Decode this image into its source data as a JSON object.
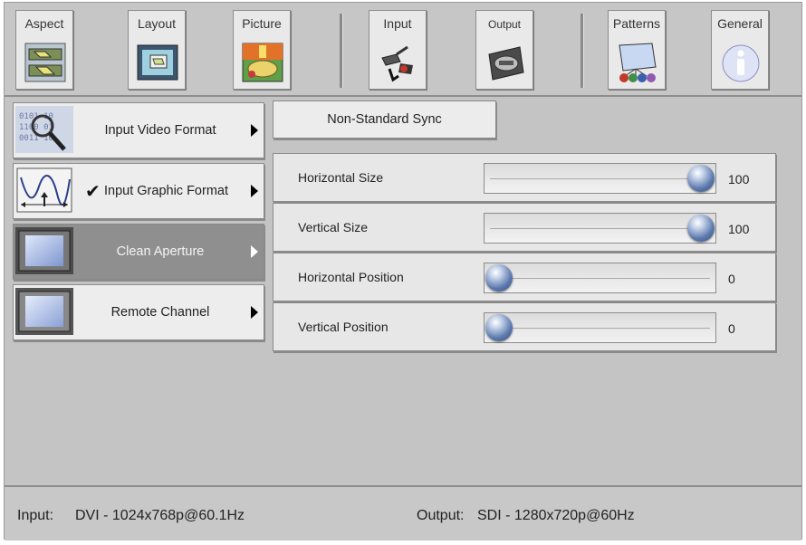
{
  "toolbar": {
    "tabs": [
      {
        "label": "Aspect",
        "icon": "aspect-icon"
      },
      {
        "label": "Layout",
        "icon": "layout-icon"
      },
      {
        "label": "Picture",
        "icon": "picture-icon"
      },
      {
        "label": "Input",
        "icon": "input-connector-icon"
      },
      {
        "label": "Output",
        "icon": "output-logo-icon"
      },
      {
        "label": "Patterns",
        "icon": "patterns-icon"
      },
      {
        "label": "General",
        "icon": "info-icon"
      }
    ]
  },
  "menu": {
    "items": [
      {
        "label": "Input Video Format",
        "icon": "magnifier-data-icon",
        "checked": false,
        "active": false
      },
      {
        "label": "Input Graphic Format",
        "icon": "waveform-icon",
        "checked": true,
        "check_mark": "✔",
        "active": false
      },
      {
        "label": "Clean Aperture",
        "icon": "aperture-frame-icon",
        "checked": false,
        "active": true
      },
      {
        "label": "Remote Channel",
        "icon": "frame-icon",
        "checked": false,
        "active": false
      }
    ]
  },
  "panel": {
    "button_label": "Non-Standard Sync",
    "rows": [
      {
        "label": "Horizontal Size",
        "value": "100",
        "level": 1.0
      },
      {
        "label": "Vertical Size",
        "value": "100",
        "level": 1.0
      },
      {
        "label": "Horizontal Position",
        "value": "0",
        "level": 0.0
      },
      {
        "label": "Vertical Position",
        "value": "0",
        "level": 0.0
      }
    ]
  },
  "status": {
    "input_label": "Input:",
    "input_value": "DVI - 1024x768p@60.1Hz",
    "output_label": "Output:",
    "output_value": "SDI - 1280x720p@60Hz"
  },
  "colors": {
    "background": "#c4c4c4",
    "active_item": "#8f8f8f",
    "knob": "#5c79ad"
  }
}
